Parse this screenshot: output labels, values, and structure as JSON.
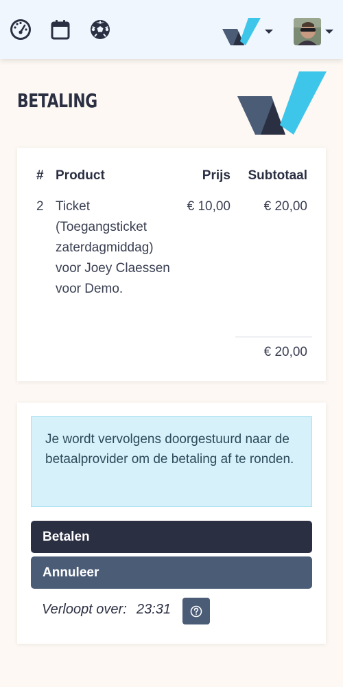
{
  "nav": {
    "icons": [
      "dashboard-icon",
      "calendar-icon",
      "soccer-ball-icon",
      "brand-logo-icon",
      "avatar"
    ]
  },
  "page": {
    "title": "BETALING"
  },
  "order": {
    "headers": {
      "qty": "#",
      "product": "Product",
      "price": "Prijs",
      "subtotal": "Subtotaal"
    },
    "rows": [
      {
        "qty": "2",
        "product": "Ticket (Toegangsticket zaterdagmiddag) voor Joey Claessen voor Demo.",
        "price": "€ 10,00",
        "subtotal": "€ 20,00"
      }
    ],
    "total": "€ 20,00"
  },
  "payment": {
    "info": "Je wordt vervolgens doorgestuurd naar de betaalprovider om de betaling af te ronden.",
    "pay_label": "Betalen",
    "cancel_label": "Annuleer",
    "expires_label": "Verloopt over:",
    "expires_value": "23:31"
  },
  "colors": {
    "primary": "#2b2f42",
    "secondary": "#4b5c76",
    "logo_blue": "#3ec6ea",
    "info_bg": "#d7f1fa"
  }
}
